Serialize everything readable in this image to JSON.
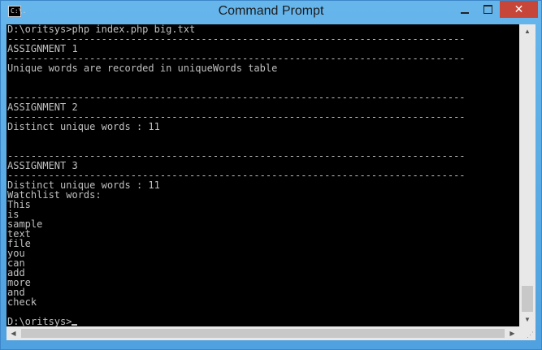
{
  "window": {
    "title": "Command Prompt",
    "app_icon_text": "C:\\.",
    "close_glyph": "✕"
  },
  "console": {
    "lines": [
      "D:\\oritsys>php index.php big.txt",
      "------------------------------------------------------------------------------",
      "ASSIGNMENT 1",
      "------------------------------------------------------------------------------",
      "Unique words are recorded in uniqueWords table",
      "",
      "",
      "------------------------------------------------------------------------------",
      "ASSIGNMENT 2",
      "------------------------------------------------------------------------------",
      "Distinct unique words : 11",
      "",
      "",
      "------------------------------------------------------------------------------",
      "ASSIGNMENT 3",
      "------------------------------------------------------------------------------",
      "Distinct unique words : 11",
      "Watchlist words:",
      "This",
      "is",
      "sample",
      "text",
      "file",
      "you",
      "can",
      "add",
      "more",
      "and",
      "check",
      "",
      "D:\\oritsys>"
    ],
    "text_color": "#c0c0c0",
    "background": "#000000"
  },
  "scrollbars": {
    "up_arrow": "▲",
    "down_arrow": "▼",
    "left_arrow": "◀",
    "right_arrow": "▶"
  }
}
